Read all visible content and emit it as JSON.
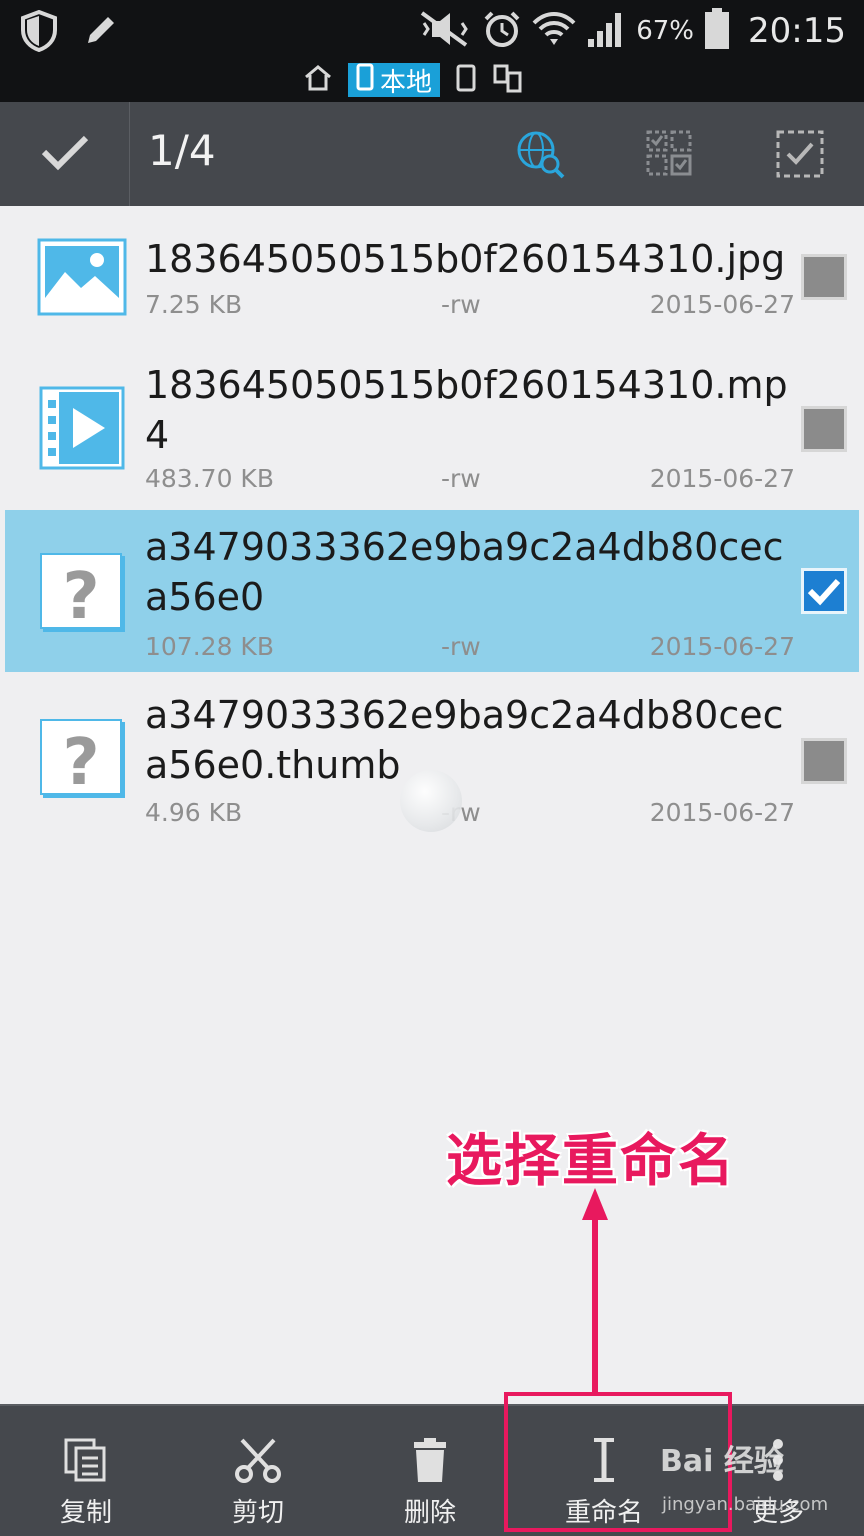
{
  "status_bar": {
    "battery_pct": "67%",
    "time": "20:15"
  },
  "location_bar": {
    "active_tab": "本地"
  },
  "action_bar": {
    "selection_count": "1/4"
  },
  "files": [
    {
      "name": "183645050515b0f260154310.jpg",
      "size": "7.25 KB",
      "perm": "-rw",
      "date": "2015-06-27",
      "type": "image",
      "checked": false
    },
    {
      "name": "183645050515b0f260154310.mp4",
      "size": "483.70 KB",
      "perm": "-rw",
      "date": "2015-06-27",
      "type": "video",
      "checked": false
    },
    {
      "name": "a3479033362e9ba9c2a4db80ceca56e0",
      "size": "107.28 KB",
      "perm": "-rw",
      "date": "2015-06-27",
      "type": "unknown",
      "checked": true
    },
    {
      "name": "a3479033362e9ba9c2a4db80ceca56e0.thumb",
      "size": "4.96 KB",
      "perm": "-rw",
      "date": "2015-06-27",
      "type": "unknown",
      "checked": false
    }
  ],
  "annotation": {
    "text": "选择重命名",
    "color": "#e8195e"
  },
  "toolbar": {
    "copy": "复制",
    "cut": "剪切",
    "delete": "删除",
    "rename": "重命名",
    "more": "更多"
  },
  "watermark": {
    "brand": "Bai 经验",
    "url": "jingyan.baidu.com"
  },
  "colors": {
    "accent": "#1aa0d8",
    "selected_row": "#8fd0ea",
    "bar_bg": "#45484d"
  }
}
